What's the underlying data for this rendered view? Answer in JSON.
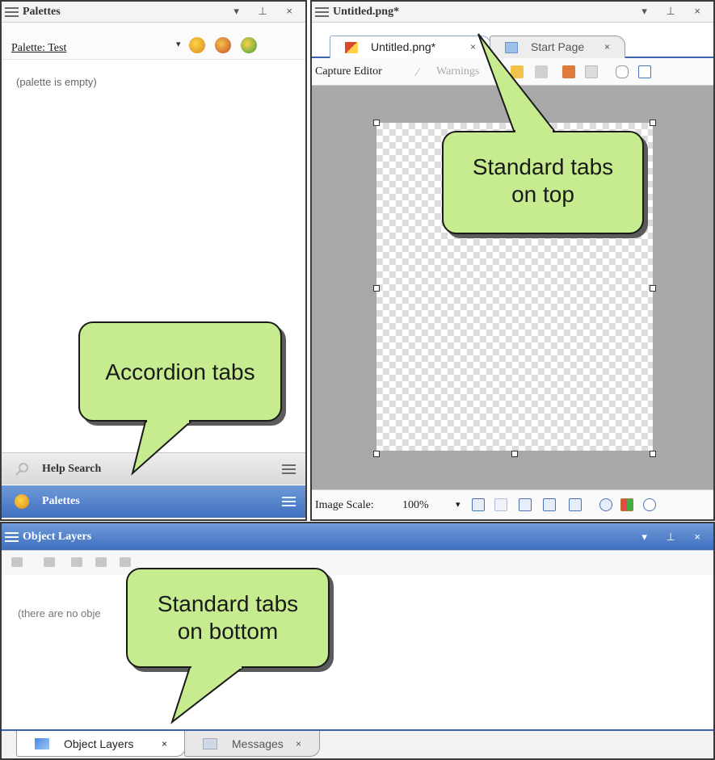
{
  "palettes_panel": {
    "title": "Palettes",
    "controls": "▾ ⊥ ×",
    "palette_label": "Palette: Test",
    "dropdown_arrow": "▾",
    "empty_text": "(palette is empty)",
    "accordion": [
      {
        "label": "Help Search",
        "icon": "search-icon"
      },
      {
        "label": "Palettes",
        "icon": "palette-icon"
      }
    ]
  },
  "editor": {
    "title": "Untitled.png*",
    "controls": "▾ ⊥ ×",
    "tabs": [
      {
        "label": "Untitled.png*",
        "close": "×",
        "icon": "image-file-icon"
      },
      {
        "label": "Start Page",
        "close": "×",
        "icon": "start-page-icon"
      }
    ],
    "toolbar": {
      "capture_label": "Capture Editor",
      "warnings_label": "Warnings"
    },
    "scale_label": "Image Scale:",
    "scale_value": "100%",
    "scale_arrow": "▾"
  },
  "layers_panel": {
    "title": "Object Layers",
    "controls": "▾ ⊥ ×",
    "empty_text": "(there are no obje",
    "tabs": [
      {
        "label": "Object Layers",
        "close": "×",
        "icon": "layers-icon"
      },
      {
        "label": "Messages",
        "close": "×",
        "icon": "messages-icon"
      }
    ]
  },
  "callouts": {
    "top": "Standard tabs on top",
    "accordion": "Accordion tabs",
    "bottom": "Standard tabs on bottom"
  },
  "colors": {
    "accent": "#3f6fbf",
    "callout": "#c6ec8f",
    "canvas_bg": "#a8a8a8"
  }
}
